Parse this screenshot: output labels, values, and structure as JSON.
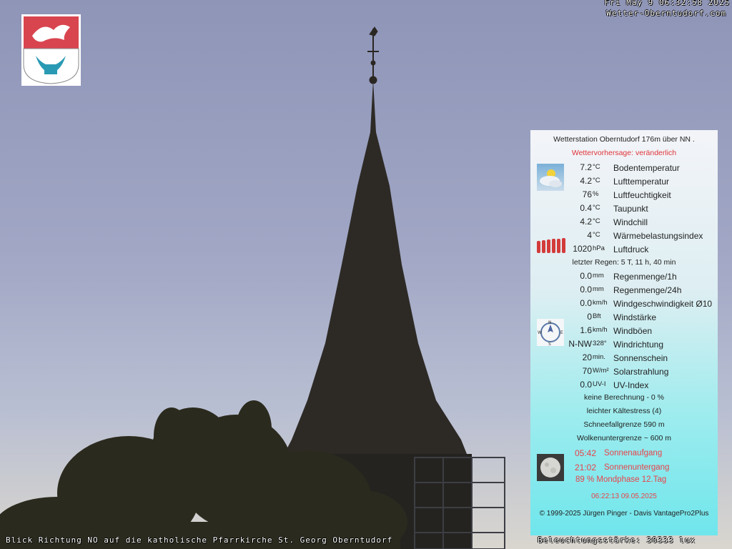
{
  "osd": {
    "datetime": "Fri May  9 06:32:58 2025",
    "site": "Wetter-Oberntudorf.com",
    "caption": "Blick Richtung NO auf die katholische Pfarrkirche St. Georg Oberntudorf",
    "illuminance": "Beleuchtungsstärke: 30333 lux"
  },
  "panel": {
    "title": "Wetterstation Oberntudorf 176m über NN  .",
    "forecast": "Wettervorhersage: veränderlich",
    "rows_a": [
      {
        "value": "7.2",
        "unit": "°C",
        "label": "Bodentemperatur"
      },
      {
        "value": "4.2",
        "unit": "°C",
        "label": "Lufttemperatur"
      },
      {
        "value": "76",
        "unit": "%",
        "label": "Luftfeuchtigkeit"
      },
      {
        "value": "0.4",
        "unit": "°C",
        "label": "Taupunkt"
      },
      {
        "value": "4.2",
        "unit": "°C",
        "label": "Windchill"
      },
      {
        "value": "4",
        "unit": "°C",
        "label": "Wärmebelastungsindex"
      },
      {
        "value": "1020",
        "unit": "hPa",
        "label": "Luftdruck"
      }
    ],
    "last_rain": "letzter Regen:  5 T, 11 h, 40 min",
    "rows_b": [
      {
        "value": "0.0",
        "unit": "mm",
        "label": "Regenmenge/1h"
      },
      {
        "value": "0.0",
        "unit": "mm",
        "label": "Regenmenge/24h"
      },
      {
        "value": "0.0",
        "unit": "km/h",
        "label": "Windgeschwindigkeit Ø10"
      },
      {
        "value": "0",
        "unit": "Bft",
        "label": "Windstärke"
      },
      {
        "value": "1.6",
        "unit": "km/h",
        "label": "Windböen"
      },
      {
        "value": "N-NW",
        "unit": "328°",
        "label": "Windrichtung"
      },
      {
        "value": "20",
        "unit": "min.",
        "label": "Sonnenschein"
      },
      {
        "value": "70",
        "unit": "W/m²",
        "label": "Solarstrahlung"
      },
      {
        "value": "0.0",
        "unit": "UV-I",
        "label": "UV-Index"
      }
    ],
    "calc": "keine Berechnung  -  0 %",
    "cold": "leichter Kältestress (4)",
    "snowline": "Schneefallgrenze  590 m",
    "cloudbase": "Wolkenuntergrenze  ~ 600 m",
    "sunrise_time": "05:42",
    "sunrise_label": "Sonnenaufgang",
    "sunset_time": "21:02",
    "sunset_label": "Sonnenuntergang",
    "moon": "89 %  Mondphase 12.Tag",
    "stamp": "06:22:13    09.05.2025",
    "copyright": "© 1999-2025 Jürgen Pinger - Davis VantagePro2Plus"
  },
  "icons": [
    "crest-icon",
    "weather-cloud-sun-icon",
    "pressure-bars-icon",
    "wind-compass-icon",
    "moon-icon"
  ]
}
